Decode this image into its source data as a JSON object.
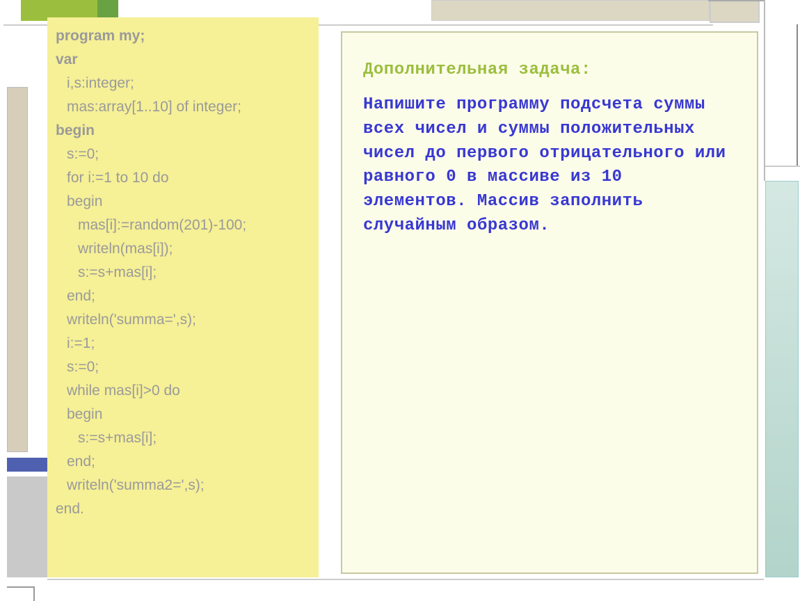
{
  "code": {
    "l1": "program my;",
    "l2": "var",
    "l3": "i,s:integer;",
    "l4": "mas:array[1..10] of integer;",
    "l5": "begin",
    "l6": "s:=0;",
    "l7": "for i:=1 to 10 do",
    "l8": "begin",
    "l9": "mas[i]:=random(201)-100;",
    "l10": "writeln(mas[i]);",
    "l11": "s:=s+mas[i];",
    "l12": "end;",
    "l13": "writeln('summa=',s);",
    "l14": "i:=1;",
    "l15": "s:=0;",
    "l16": "while mas[i]>0 do",
    "l17": "begin",
    "l18": "s:=s+mas[i];",
    "l19": "end;",
    "l20": "writeln('summa2=',s);",
    "l21": "end."
  },
  "task": {
    "title": "Дополнительная задача:",
    "body": "Напишите программу подсчета суммы всех чисел и суммы положительных чисел до первого отрицательного или равного 0 в массиве из 10 элементов. Массив заполнить случайным образом."
  }
}
